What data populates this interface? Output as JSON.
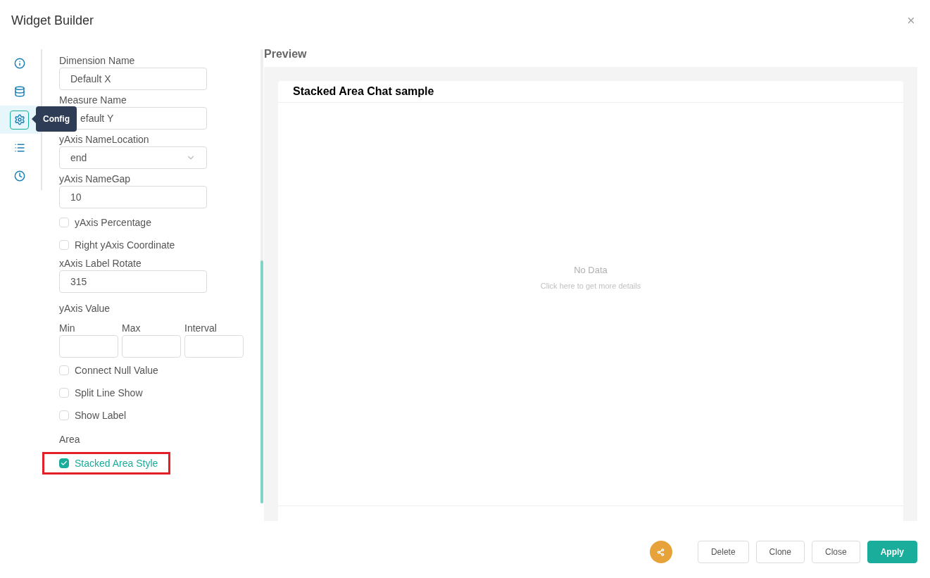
{
  "window": {
    "title": "Widget Builder"
  },
  "nav": [
    {
      "selected": false
    },
    {
      "selected": false
    },
    {
      "selected": true,
      "tooltip": "Config"
    },
    {
      "selected": false
    },
    {
      "selected": false
    }
  ],
  "form": [
    {
      "kind": "input",
      "label": "Dimension Name",
      "value": "Default X"
    },
    {
      "kind": "input",
      "label": "Measure Name",
      "value": "efault Y",
      "covered": true
    },
    {
      "kind": "select",
      "label": "yAxis NameLocation",
      "value": "end"
    },
    {
      "kind": "input",
      "label": "yAxis NameGap",
      "value": "10"
    },
    {
      "kind": "checkbox",
      "label": "yAxis Percentage",
      "checked": false,
      "highlighted": false
    },
    {
      "kind": "checkbox",
      "label": "Right yAxis Coordinate",
      "checked": false,
      "highlighted": false
    },
    {
      "kind": "input",
      "label": "xAxis Label Rotate",
      "value": "315"
    },
    {
      "kind": "heading",
      "label": "yAxis Value"
    },
    {
      "kind": "triple",
      "labels": [
        "Min",
        "Max",
        "Interval"
      ]
    },
    {
      "kind": "checkbox",
      "label": "Connect Null Value",
      "checked": false,
      "highlighted": false
    },
    {
      "kind": "checkbox",
      "label": "Split Line Show",
      "checked": false,
      "highlighted": false
    },
    {
      "kind": "checkbox",
      "label": "Show Label",
      "checked": false,
      "highlighted": false
    },
    {
      "kind": "heading",
      "label": "Area"
    },
    {
      "kind": "checkbox",
      "label": "Stacked Area Style",
      "checked": true,
      "highlighted": true
    }
  ],
  "preview": {
    "title": "Preview",
    "card_title": "Stacked Area Chat sample",
    "empty_title": "No Data",
    "empty_hint": "Click here to get more details"
  },
  "buttons": [
    {
      "label": "Delete",
      "primary": false
    },
    {
      "label": "Clone",
      "primary": false
    },
    {
      "label": "Close",
      "primary": false
    },
    {
      "label": "Apply",
      "primary": true
    }
  ]
}
